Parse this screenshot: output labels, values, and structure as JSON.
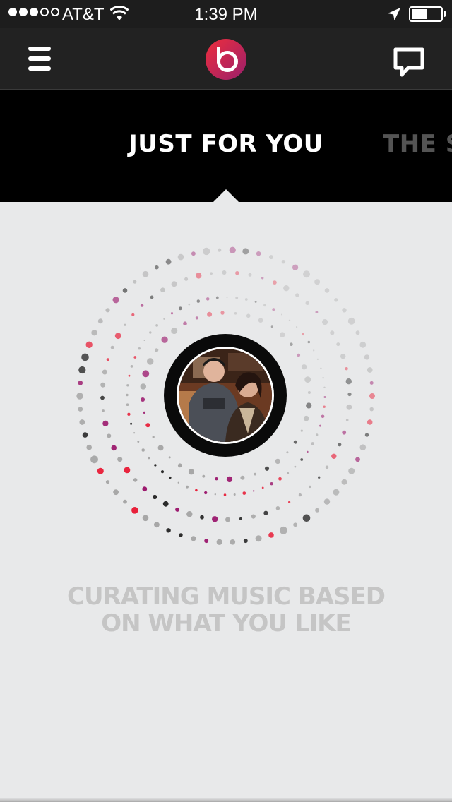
{
  "status_bar": {
    "signal_bars": 3,
    "signal_total": 5,
    "carrier": "AT&T",
    "time": "1:39 PM",
    "battery_percent": 55,
    "icons": [
      "wifi-icon",
      "location-arrow-icon",
      "battery-icon"
    ]
  },
  "nav": {
    "menu_icon": "hamburger-menu-icon",
    "logo_icon": "beats-logo",
    "chat_icon": "speech-bubble-icon"
  },
  "tabs": [
    {
      "label": "JUST FOR YOU",
      "active": true
    },
    {
      "label": "THE S",
      "active": false
    }
  ],
  "main": {
    "loading_line1": "CURATING MUSIC BASED",
    "loading_line2": "ON WHAT YOU LIKE"
  },
  "colors": {
    "accent_red": "#e8203a",
    "accent_magenta": "#9c1a6e",
    "dot_gray": "#a7a7a7",
    "dot_dark": "#2b2b2b",
    "background": "#e8e9ea"
  }
}
